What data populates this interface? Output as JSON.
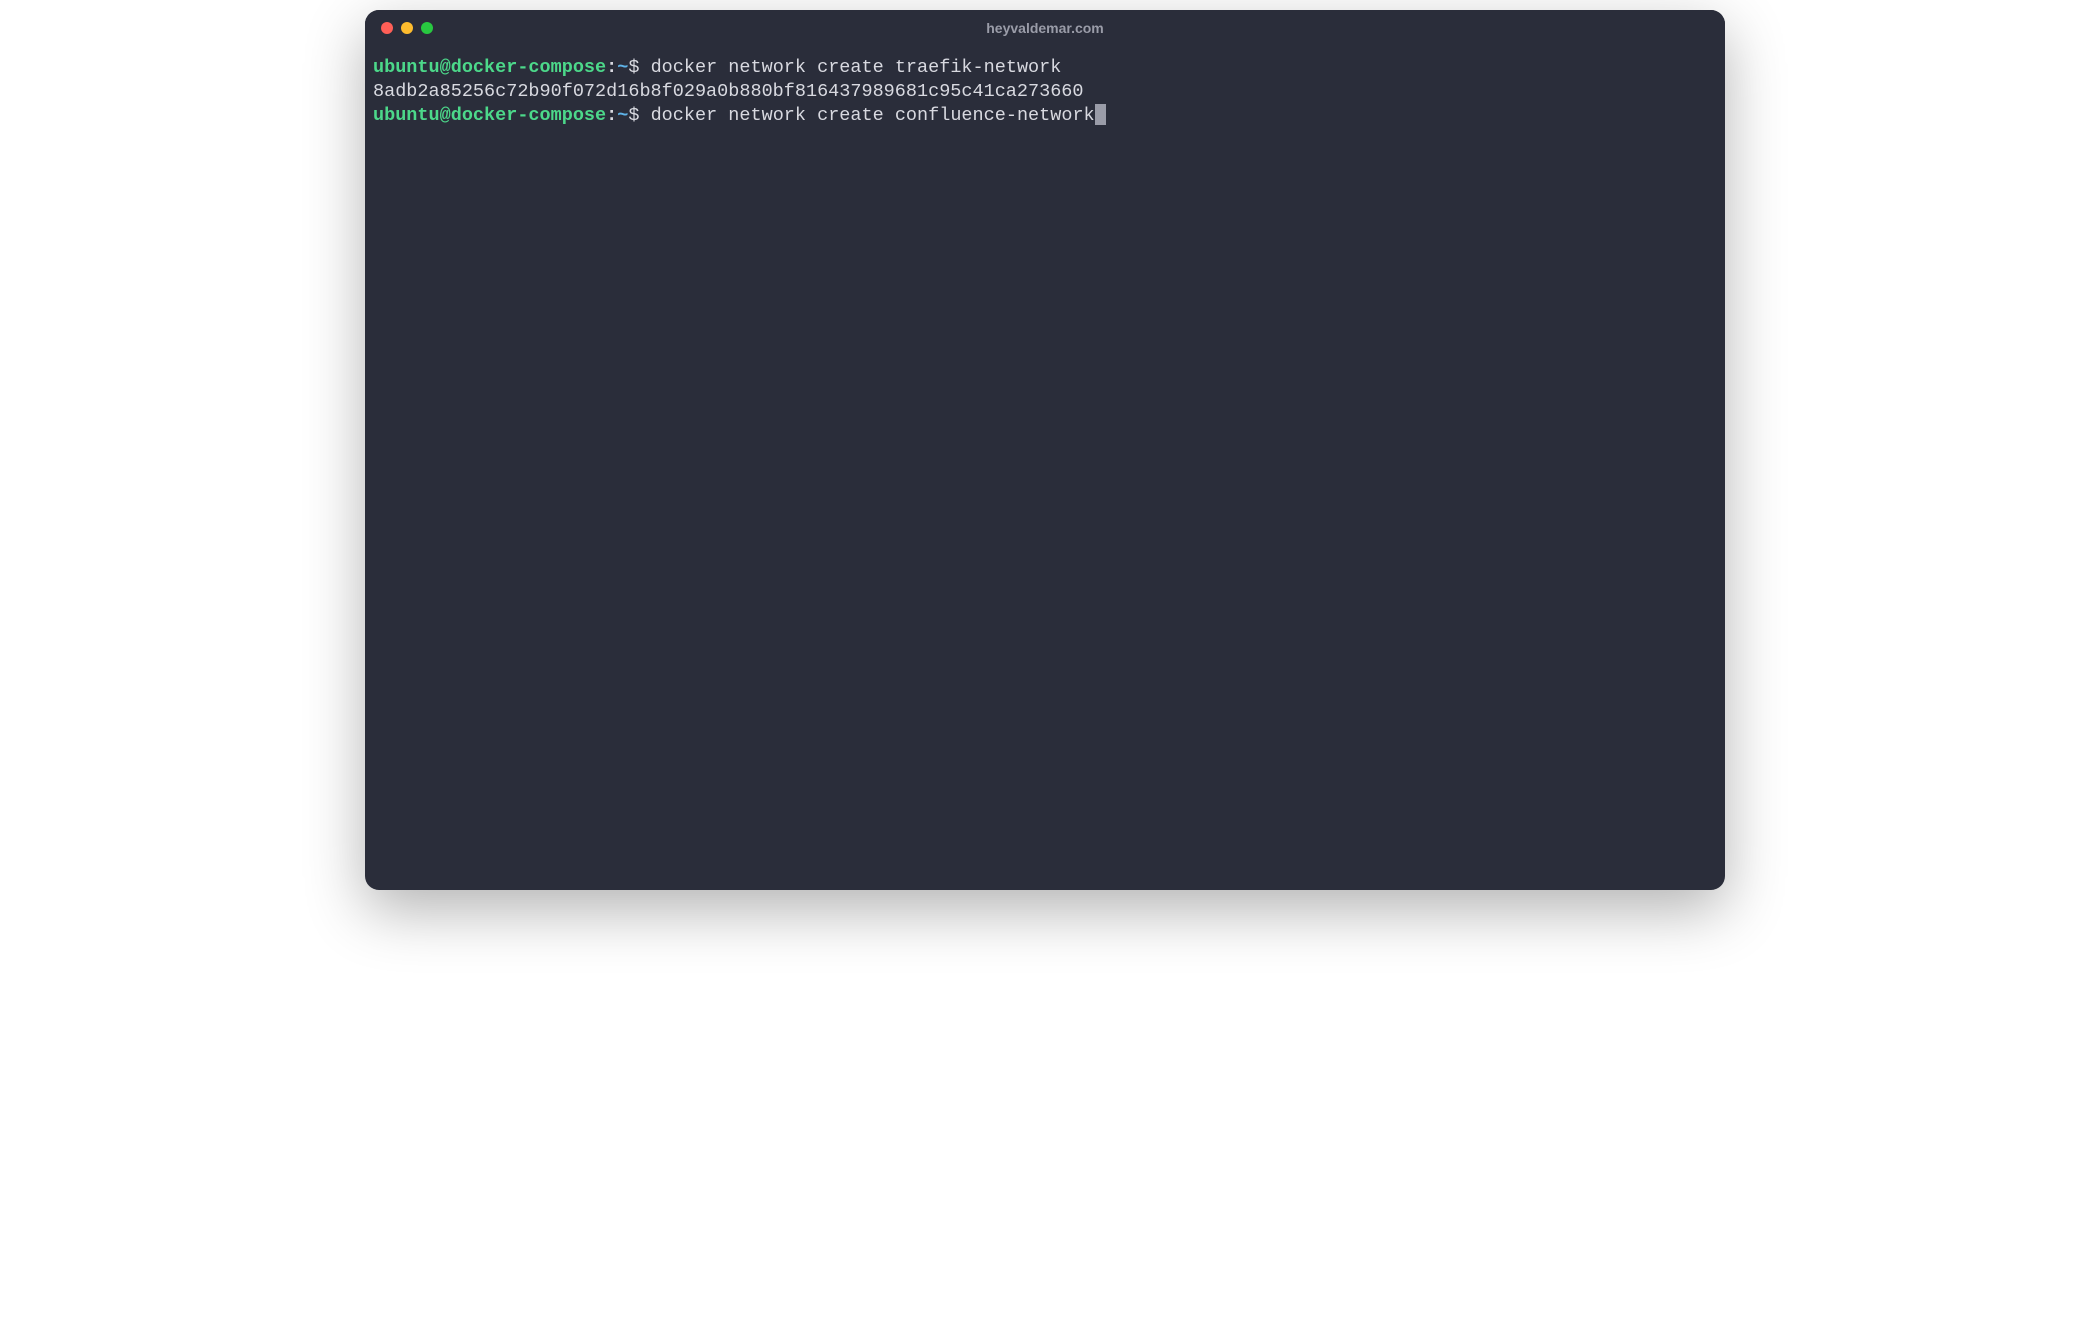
{
  "window": {
    "title": "heyvaldemar.com"
  },
  "terminal": {
    "lines": [
      {
        "type": "prompt",
        "user": "ubuntu@docker-compose",
        "colon": ":",
        "path": "~",
        "dollar": "$ ",
        "command": "docker network create traefik-network"
      },
      {
        "type": "output",
        "text": "8adb2a85256c72b90f072d16b8f029a0b880bf816437989681c95c41ca273660"
      },
      {
        "type": "prompt",
        "user": "ubuntu@docker-compose",
        "colon": ":",
        "path": "~",
        "dollar": "$ ",
        "command": "docker network create confluence-network",
        "cursor": true
      }
    ]
  }
}
